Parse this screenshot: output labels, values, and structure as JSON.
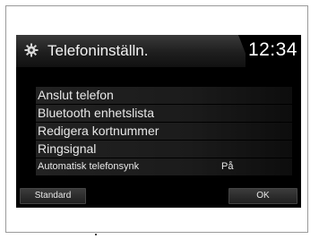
{
  "header": {
    "icon": "gear-icon",
    "title": "Telefoninställn.",
    "clock": "12:34"
  },
  "menu": {
    "items": [
      {
        "label": "Anslut telefon"
      },
      {
        "label": "Bluetooth enhetslista"
      },
      {
        "label": "Redigera kortnummer"
      },
      {
        "label": "Ringsignal"
      },
      {
        "label": "Automatisk telefonsynk",
        "value": "På"
      }
    ]
  },
  "buttons": {
    "standard_label": "Standard",
    "ok_label": "OK"
  },
  "colors": {
    "screen_bg": "#000000",
    "text": "#e8e8e8",
    "header_gradient_top": "#3a3a3a"
  }
}
